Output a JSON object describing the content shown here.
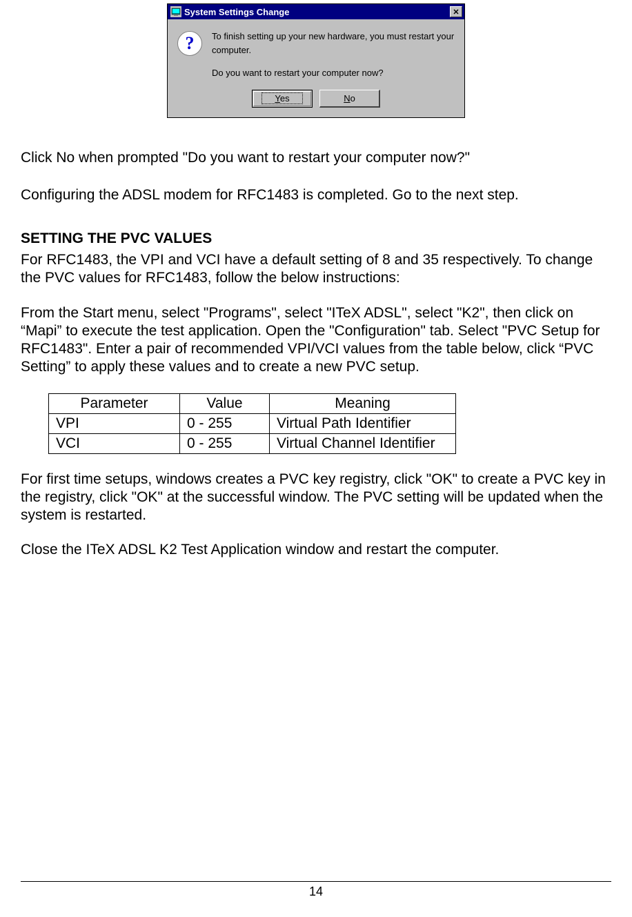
{
  "dialog": {
    "title": "System Settings Change",
    "message_line1": "To finish setting up your new hardware, you must restart your computer.",
    "message_line2": "Do you want to restart your computer now?",
    "yes_label": "Yes",
    "no_label": "No",
    "question_mark": "?",
    "close_glyph": "✕"
  },
  "paragraphs": {
    "p1": "Click No when prompted \"Do you want to restart your computer now?\"",
    "p2": "Configuring the ADSL modem for RFC1483 is completed.  Go to the next step.",
    "heading": "SETTING THE PVC VALUES",
    "p3": "For RFC1483, the VPI and VCI have a default setting of 8 and 35 respectively.  To change the PVC values for RFC1483, follow the below instructions:",
    "p4": "From the Start menu, select \"Programs\", select \"ITeX ADSL\", select \"K2\", then click on “Mapi” to execute the test application.  Open the \"Configuration\" tab.  Select \"PVC Setup for RFC1483\".  Enter a pair of recommended VPI/VCI values from the table below, click “PVC Setting” to apply these values and to create a new PVC setup.",
    "p5": "For first time setups, windows creates a PVC key registry, click \"OK\" to create a PVC key in the registry, click \"OK\" at the successful window.  The PVC setting will be updated when the system is restarted.",
    "p6": "Close the ITeX ADSL K2 Test Application window and restart the computer."
  },
  "table": {
    "headers": {
      "parameter": "Parameter",
      "value": "Value",
      "meaning": "Meaning"
    },
    "rows": [
      {
        "parameter": "VPI",
        "value": "0 - 255",
        "meaning": "Virtual Path Identifier"
      },
      {
        "parameter": "VCI",
        "value": "0 - 255",
        "meaning": "Virtual Channel Identifier"
      }
    ]
  },
  "page_number": "14"
}
